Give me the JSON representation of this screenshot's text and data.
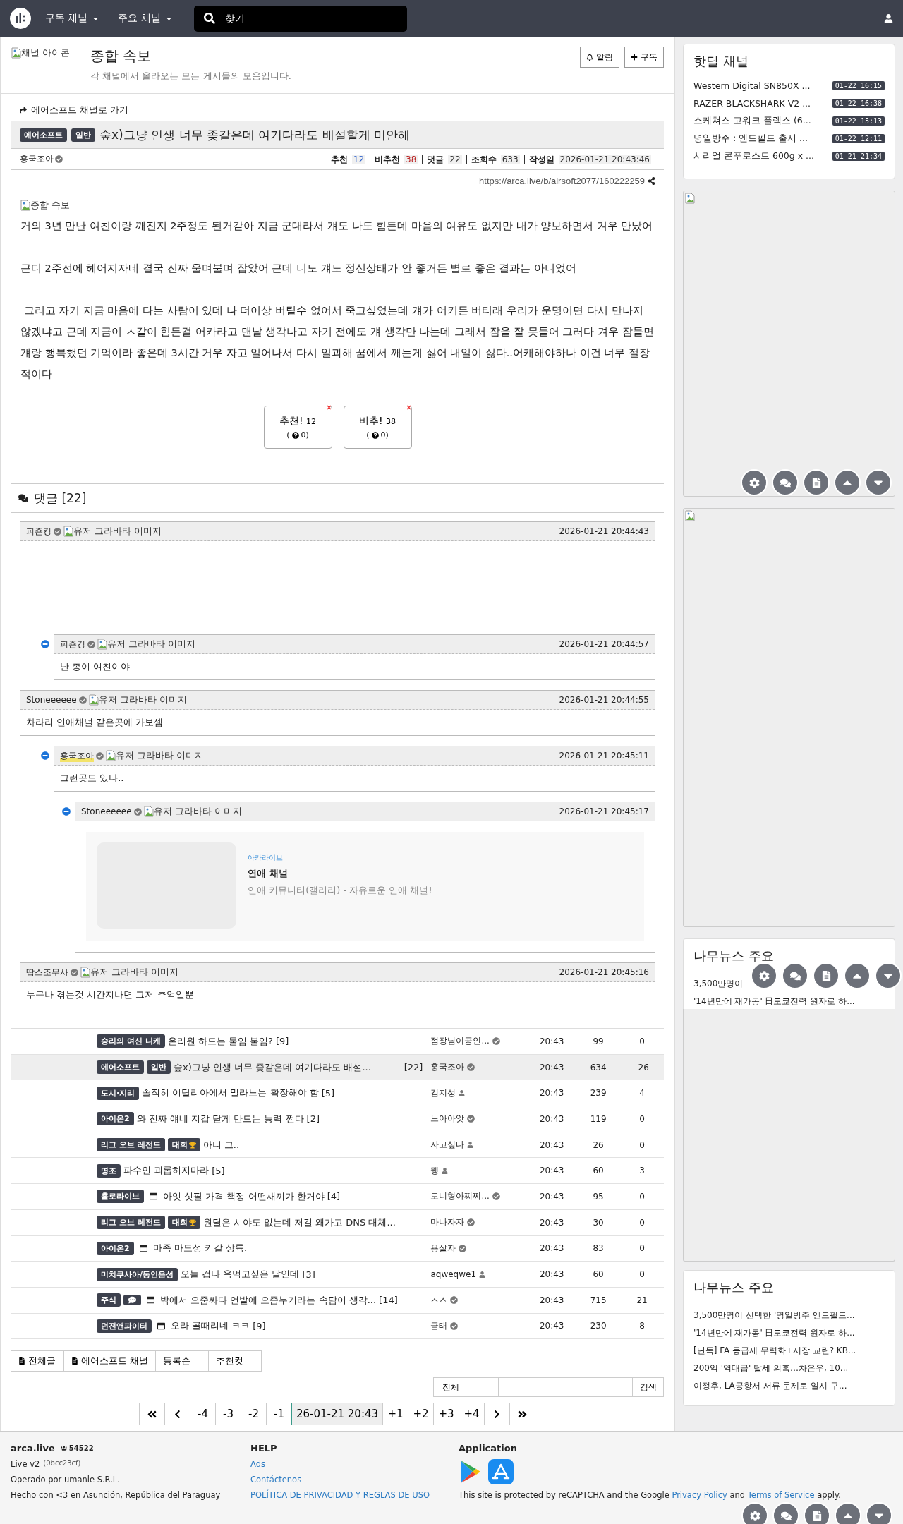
{
  "nav": {
    "menus": [
      {
        "label": "구독 채널"
      },
      {
        "label": "주요 채널"
      }
    ],
    "search_placeholder": "찾기"
  },
  "channel": {
    "icon_alt": "채널 아이콘",
    "title": "종합 속보",
    "description": "각 채널에서 올라오는 모든 게시물의 모음입니다.",
    "buttons": [
      {
        "kind": "bell",
        "label": "알림"
      },
      {
        "kind": "plus",
        "label": "구독"
      }
    ]
  },
  "post": {
    "back_link": "에어소프트 채널로 가기",
    "badges": [
      "에어소프트",
      "일반"
    ],
    "title": "숲x)그냥 인생 너무 좆같은데 여기다라도 배설할게 미안해",
    "author": "홍국조아",
    "stats": [
      {
        "label": "추천",
        "value": "12",
        "kind": "up"
      },
      {
        "label": "비추천",
        "value": "38",
        "kind": "down"
      },
      {
        "label": "댓글",
        "value": "22",
        "kind": "plain"
      },
      {
        "label": "조회수",
        "value": "633",
        "kind": "plain"
      },
      {
        "label": "작성일",
        "value": "2026-01-21 20:43:46",
        "kind": "plain"
      }
    ],
    "url": "https://arca.live/b/airsoft2077/160222259",
    "image_alt": "종합 속보",
    "paragraphs": [
      "거의 3년 만난 여친이랑 깨진지 2주정도 된거같아 지금 군대라서 걔도 나도 힘든데 마음의 여유도 없지만 내가 양보하면서 겨우 만났어",
      "근디 2주전에 헤어지자네 결국 진짜 울며불며 잡았어 근데 너도 걔도 정신상태가 안 좋거든 별로 좋은 결과는 아니었어",
      " 그리고 자기 지금 마음에 다는 사람이 있데 나 더이상 버틸수 없어서 죽고싶었는데 걔가 어키든 버티래 우리가 운명이면 다시 만나지 않겠냐고 근데 지금이 ㅈ같이 힘든걸 어카라고 맨날 생각나고 자기 전에도 걔 생각만 나는데 그래서 잠을 잘 못들어 그러다 겨우 잠들면 걔랑 행복했던 기억이라 좋은데 3시간 거우 자고 일어나서 다시 일과해 꿈에서 깨는게 싫어 내일이 싫다..어캐해야하나 이건 너무 절장적이다"
    ],
    "votes": [
      {
        "label": "추천!",
        "count": "12",
        "sub_before": "(",
        "sub_after": "0)"
      },
      {
        "label": "비추!",
        "count": "38",
        "sub_before": "(",
        "sub_after": "0)"
      }
    ]
  },
  "comments": {
    "heading": "댓글 [22]",
    "items": [
      {
        "author": "피죤킹",
        "avatar_alt": "유저 그라바타 이미지",
        "time": "2026-01-21 20:44:43",
        "kind": "blank",
        "op": false,
        "children": [
          {
            "author": "피죤킹",
            "avatar_alt": "유저 그라바타 이미지",
            "time": "2026-01-21 20:44:57",
            "kind": "text",
            "text": "난 총이 여친이야",
            "op": false
          }
        ]
      },
      {
        "author": "Stoneeeeee",
        "avatar_alt": "유저 그라바타 이미지",
        "time": "2026-01-21 20:44:55",
        "kind": "text",
        "text": "차라리 연애채널 같은곳에 가보셈",
        "op": false,
        "children": [
          {
            "author": "홍국조아",
            "avatar_alt": "유저 그라바타 이미지",
            "time": "2026-01-21 20:45:11",
            "kind": "text",
            "text": "그런곳도 있나..",
            "op": true,
            "children": [
              {
                "author": "Stoneeeeee",
                "avatar_alt": "유저 그라바타 이미지",
                "time": "2026-01-21 20:45:17",
                "kind": "link",
                "op": false,
                "link": {
                  "site": "아카라이브",
                  "title": "연애 채널",
                  "description": "연애 커뮤니티(갤러리) - 자유로운 연애 채널!"
                }
              }
            ]
          }
        ]
      },
      {
        "author": "땁스조무사",
        "avatar_alt": "유저 그라바타 이미지",
        "time": "2026-01-21 20:45:16",
        "kind": "text",
        "text": "누구나 겪는것 시간지나면 그저 추억일뿐",
        "op": false
      }
    ]
  },
  "board": {
    "rows": [
      {
        "badges": [
          {
            "kind": "text",
            "label": "승리의 여신 니케"
          }
        ],
        "has_image": false,
        "title": "온리원 하드는 물임 불임?",
        "count": "[9]",
        "author": "점장님이공인...",
        "verified": true,
        "time": "20:43",
        "views": "99",
        "rating": "0",
        "selected": false
      },
      {
        "badges": [
          {
            "kind": "text",
            "label": "에어소프트"
          },
          {
            "kind": "text",
            "label": "일반"
          }
        ],
        "has_image": false,
        "title": "숲x)그냥 인생 너무 좆같은데 여기다라도 배설...",
        "count": "[22]",
        "author": "홍국조아",
        "verified": true,
        "time": "20:43",
        "views": "634",
        "rating": "-26",
        "selected": true
      },
      {
        "badges": [
          {
            "kind": "text",
            "label": "도시·지리"
          }
        ],
        "has_image": false,
        "title": "솔직히 이탈리아에서 밀라노는 확장해야 함",
        "count": "[5]",
        "author": "김지성",
        "verified": false,
        "time": "20:43",
        "views": "239",
        "rating": "4",
        "selected": false
      },
      {
        "badges": [
          {
            "kind": "text",
            "label": "아이온2"
          }
        ],
        "has_image": false,
        "title": "와 진짜 얘네 지갑 닫게 만드는 능력 쩐다",
        "count": "[2]",
        "author": "느아아앗",
        "verified": true,
        "time": "20:43",
        "views": "119",
        "rating": "0",
        "selected": false
      },
      {
        "badges": [
          {
            "kind": "text",
            "label": "리그 오브 레전드"
          },
          {
            "kind": "trophy",
            "label": "대회"
          }
        ],
        "has_image": false,
        "title": "아니 그..",
        "author": "자고싶다",
        "verified": false,
        "time": "20:43",
        "views": "26",
        "rating": "0",
        "selected": false
      },
      {
        "badges": [
          {
            "kind": "text",
            "label": "명조"
          }
        ],
        "has_image": false,
        "title": "파수인 괴롭히지마라",
        "count": "[5]",
        "author": "뮁",
        "verified": false,
        "time": "20:43",
        "views": "60",
        "rating": "3",
        "selected": false
      },
      {
        "badges": [
          {
            "kind": "text",
            "label": "홀로라이브"
          }
        ],
        "has_image": true,
        "title": "아잇 싯팔 가격 책정 어떤새끼가 한거야",
        "count": "[4]",
        "author": "로니형아찌찌...",
        "verified": true,
        "time": "20:43",
        "views": "95",
        "rating": "0",
        "selected": false
      },
      {
        "badges": [
          {
            "kind": "text",
            "label": "리그 오브 레전드"
          },
          {
            "kind": "trophy",
            "label": "대회"
          }
        ],
        "has_image": false,
        "title": "원딜은 시야도 없는데 저길 왜가고 DNS 대체...",
        "author": "마나자자",
        "verified": true,
        "time": "20:43",
        "views": "30",
        "rating": "0",
        "selected": false
      },
      {
        "badges": [
          {
            "kind": "text",
            "label": "아이온2"
          }
        ],
        "has_image": true,
        "title": "마족 마도성 키갈 상륙.",
        "author": "용살자",
        "verified": true,
        "time": "20:43",
        "views": "83",
        "rating": "0",
        "selected": false
      },
      {
        "badges": [
          {
            "kind": "text",
            "label": "미치쿠사아/동인음성"
          }
        ],
        "has_image": false,
        "title": "오늘 겁나 욕먹고싶은 날인데",
        "count": "[3]",
        "author": "aqweqwe1",
        "verified": false,
        "time": "20:43",
        "views": "60",
        "rating": "0",
        "selected": false
      },
      {
        "badges": [
          {
            "kind": "text",
            "label": "주식"
          },
          {
            "kind": "chat"
          }
        ],
        "has_image": true,
        "title": "밖에서 오줌싸다 언발에 오줌누기라는 속담이 생각...",
        "count": "[14]",
        "author": "ㅈㅅ",
        "verified": true,
        "time": "20:43",
        "views": "715",
        "rating": "21",
        "selected": false
      },
      {
        "badges": [
          {
            "kind": "text",
            "label": "던전앤파이터"
          }
        ],
        "has_image": true,
        "title": "오라 골때리네 ㅋㅋ",
        "count": "[9]",
        "author": "금태",
        "verified": true,
        "time": "20:43",
        "views": "230",
        "rating": "8",
        "selected": false
      }
    ],
    "tabs": [
      {
        "kind": "doc",
        "label": "전체글"
      },
      {
        "kind": "doc",
        "label": "에어소프트 채널"
      },
      {
        "kind": "plain",
        "label": "등록순"
      },
      {
        "kind": "plain",
        "label": "추천컷"
      }
    ],
    "search": {
      "scope": "전체",
      "button": "검색"
    },
    "pages": [
      {
        "kind": "first",
        "selected": false
      },
      {
        "kind": "prev",
        "selected": false
      },
      {
        "kind": "page",
        "label": "-4",
        "selected": false
      },
      {
        "kind": "page",
        "label": "-3",
        "selected": false
      },
      {
        "kind": "page",
        "label": "-2",
        "selected": false
      },
      {
        "kind": "page",
        "label": "-1",
        "selected": false
      },
      {
        "kind": "page",
        "label": "26-01-21 20:43",
        "selected": true
      },
      {
        "kind": "page",
        "label": "+1",
        "selected": false
      },
      {
        "kind": "page",
        "label": "+2",
        "selected": false
      },
      {
        "kind": "page",
        "label": "+3",
        "selected": false
      },
      {
        "kind": "page",
        "label": "+4",
        "selected": false
      },
      {
        "kind": "next",
        "selected": false
      },
      {
        "kind": "last",
        "selected": false
      }
    ]
  },
  "sidebar": {
    "hotdeal": {
      "title": "핫딜 채널",
      "items": [
        {
          "title": "Western Digital SN850X ...",
          "date": "01-22 16:15"
        },
        {
          "title": "RAZER BLACKSHARK V2 ...",
          "date": "01-22 16:38"
        },
        {
          "title": "스케쳐스 고워크 플렉스 (6...",
          "date": "01-22 15:13"
        },
        {
          "title": "명일방주 : 엔드필드 출시 ...",
          "date": "01-22 12:11"
        },
        {
          "title": "시리얼 콘푸로스트 600g x ...",
          "date": "01-21 21:34"
        }
      ]
    },
    "news_top": {
      "title": "나무뉴스 주요",
      "items": [
        "3,500만명이",
        "'14년만에 재가동' 日도쿄전력 원자로 하..."
      ]
    },
    "news": {
      "title": "나무뉴스 주요",
      "items": [
        "3,500만명이 선택한 '명일방주 엔드필드...",
        "'14년만에 재가동' 日도쿄전력 원자로 하...",
        "[단독] FA 등급제 무력화+시장 교란? KB...",
        "200억 '역대급' 탈세 의혹…차은우, 10...",
        "이정후, LA공항서 서류 문제로 일시 구..."
      ]
    }
  },
  "footer": {
    "site": "arca.live",
    "users": "54522",
    "version": "Live v2",
    "build": "(0bcc23cf)",
    "operator": "Operado por umanle S.R.L.",
    "made": "Hecho con <3 en Asunción, República del Paraguay",
    "help_title": "HELP",
    "help_links": [
      "Ads",
      "Contáctenos",
      "POLÍTICA DE PRIVACIDAD Y REGLAS DE USO"
    ],
    "app_title": "Application",
    "recaptcha": {
      "before": "This site is protected by reCAPTCHA and the Google ",
      "link1": "Privacy Policy",
      "middle": " and ",
      "link2": "Terms of Service",
      "after": " apply."
    }
  }
}
